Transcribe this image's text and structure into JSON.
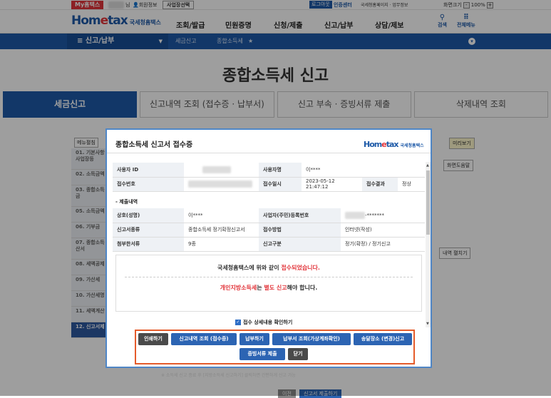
{
  "topbar": {
    "my_hometax": "My홈택스",
    "name_suffix": "님",
    "member_info": "회원정보",
    "biz_select": "사업장선택",
    "logout": "로그아웃",
    "cert_center": "인증센터",
    "links": "국세청홈페이지 · 업무정보",
    "screen_size": "화면크기",
    "zoom": "100%",
    "zoom_minus": "-",
    "zoom_plus": "+"
  },
  "header": {
    "logo": "Hometax",
    "logo_sub": "국세청홈택스",
    "nav": [
      "조회/발급",
      "민원증명",
      "신청/제출",
      "신고/납부",
      "상담/제보"
    ],
    "search": "검색",
    "all_menu": "전체메뉴"
  },
  "subnav": {
    "current": "신고/납부",
    "crumbs": [
      "세금신고",
      "종합소득세"
    ]
  },
  "page": {
    "title": "종합소득세 신고",
    "tabs": [
      "세금신고",
      "신고내역 조회 (접수증 · 납부서)",
      "신고 부속 · 증빙서류 제출",
      "삭제내역 조회"
    ]
  },
  "leftmenu": {
    "edit": "메뉴펼침",
    "items": [
      "01. 기본사항\n사업장등",
      "02. 소득금액",
      "03. 종합소득\n금",
      "05. 소득금액",
      "06. 기부금",
      "07. 종합소득\n산서",
      "08. 세액공제",
      "09. 가산세",
      "10. 가산세명",
      "11. 세액계산",
      "12. 신고서제"
    ]
  },
  "right": {
    "preview": "미리보기",
    "help": "화면도움말",
    "helper": "내역 펼치기"
  },
  "modal": {
    "title": "종합소득세 신고서 접수증",
    "logo": "Hometax",
    "logo_sub": "국세청홈택스",
    "row1": {
      "user_id_label": "사용자 ID",
      "user_name_label": "사용자명",
      "user_name": "이****"
    },
    "row2": {
      "receipt_no_label": "접수번호",
      "receipt_time_label": "접수일시",
      "receipt_time": "2023-05-12 21:47:12",
      "result_label": "접수결과",
      "result": "정상"
    },
    "section": "- 제출내역",
    "row3": {
      "company_label": "상호(성명)",
      "company": "이****",
      "biz_no_label": "사업자(주민)등록번호",
      "biz_no": "-*******"
    },
    "row4": {
      "type_label": "신고서종류",
      "type": "종합소득세 정기확정신고서",
      "method_label": "접수방법",
      "method": "인터넷(작성)"
    },
    "row5": {
      "attach_label": "첨부한서류",
      "attach": "9종",
      "category_label": "신고구분",
      "category": "정기(확정) / 정기신고"
    },
    "notice1_a": "국세청홈택스에 위와 같이 ",
    "notice1_b": "접수되었습니다.",
    "notice2_a": "개인지방소득세",
    "notice2_b": "는 ",
    "notice2_c": "별도 신고",
    "notice2_d": "해야 합니다.",
    "confirm": "접수 상세내용 확인하기",
    "buttons": {
      "print": "인쇄하기",
      "history": "신고내역 조회 (접수증)",
      "pay": "납부하기",
      "pay_slip": "납부서 조회(가상계좌확인)",
      "tax_office": "송달장소 (변경)신고",
      "evidence": "증빙서류 제출",
      "close": "닫기"
    }
  },
  "bottom": {
    "note": "※ 소득세 신고 종료 후 [지방소득세 신고하기] 클릭하면 간편하게 신고 가능",
    "prev": "이전",
    "submit": "신고서 제출하기"
  }
}
